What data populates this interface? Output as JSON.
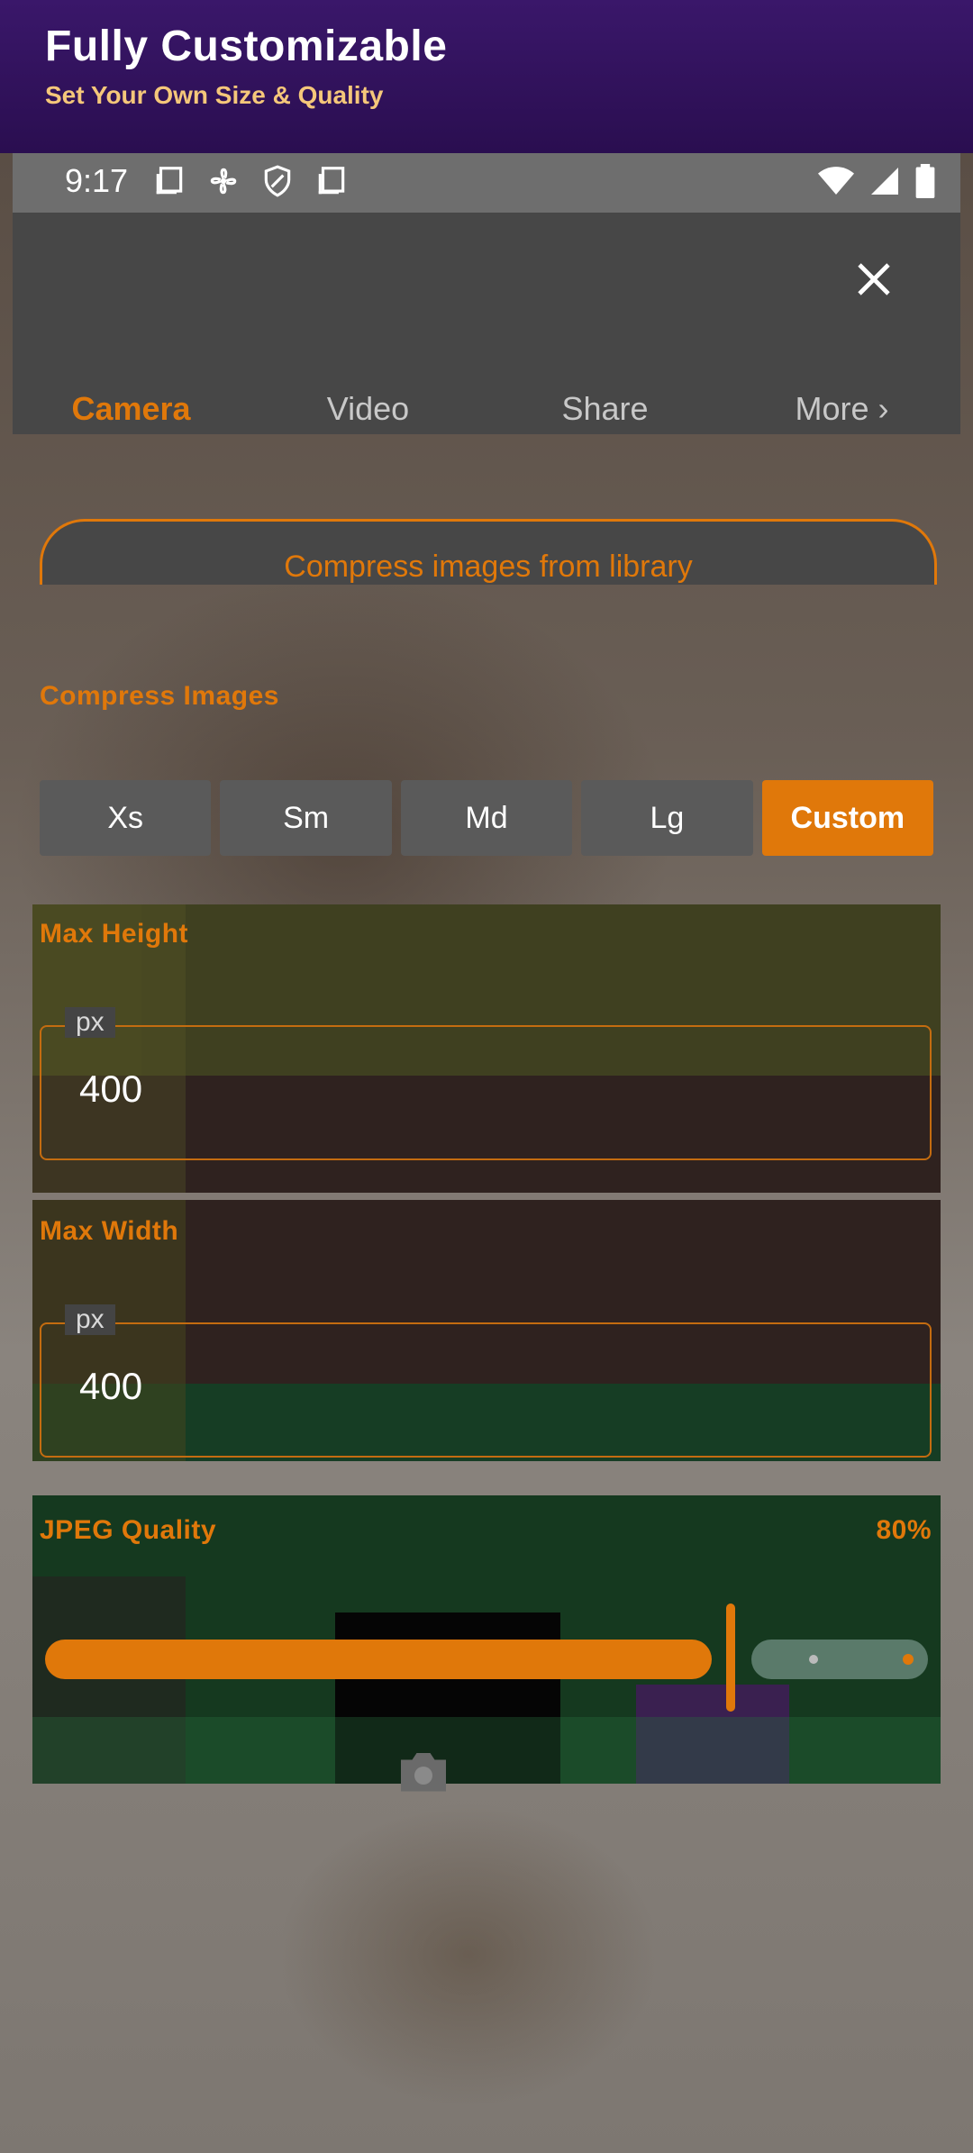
{
  "promo": {
    "title": "Fully Customizable",
    "subtitle": "Set Your Own Size & Quality"
  },
  "status_bar": {
    "time": "9:17",
    "icons": [
      "notification-icon",
      "fan-icon",
      "shield-icon",
      "notification-icon",
      "wifi-icon",
      "signal-icon",
      "battery-icon"
    ]
  },
  "tabs": [
    {
      "label": "Camera",
      "active": true
    },
    {
      "label": "Video",
      "active": false
    },
    {
      "label": "Share",
      "active": false
    },
    {
      "label": "More ›",
      "active": false
    }
  ],
  "library_button": {
    "label": "Compress images from library"
  },
  "compress": {
    "label": "Compress Images",
    "sizes": [
      {
        "label": "Xs",
        "active": false
      },
      {
        "label": "Sm",
        "active": false
      },
      {
        "label": "Md",
        "active": false
      },
      {
        "label": "Lg",
        "active": false
      },
      {
        "label": "Custom",
        "active": true
      }
    ]
  },
  "max_height": {
    "label": "Max Height",
    "unit": "px",
    "value": "400"
  },
  "max_width": {
    "label": "Max Width",
    "unit": "px",
    "value": "400"
  },
  "jpeg_quality": {
    "label": "JPEG Quality",
    "value_text": "80%",
    "value": 0.8
  },
  "colors": {
    "accent": "#e0780a",
    "promo_bg": "#2a0e50",
    "promo_subtitle": "#f5c77a",
    "panel_bg": "#474747"
  }
}
